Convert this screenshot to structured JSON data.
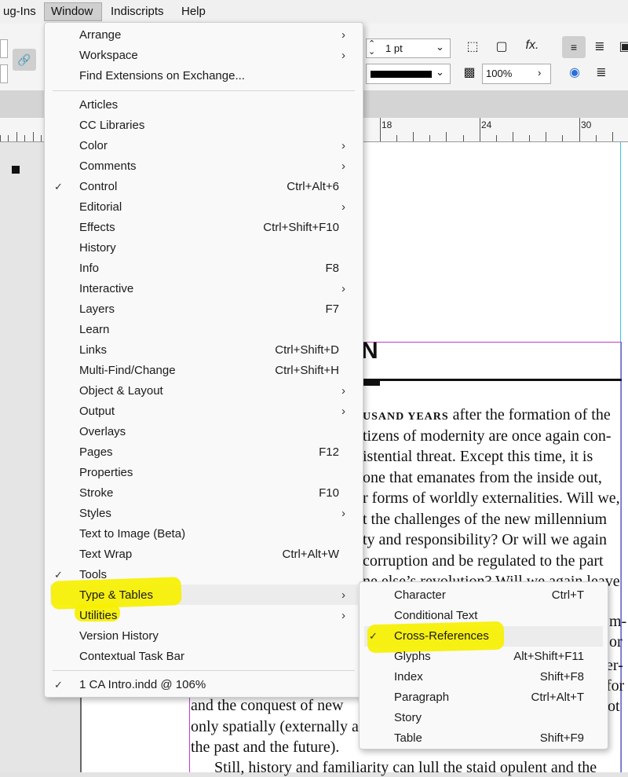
{
  "menubar": {
    "items": [
      {
        "label": "ug-Ins"
      },
      {
        "label": "Window"
      },
      {
        "label": "Indiscripts"
      },
      {
        "label": "Help"
      }
    ]
  },
  "control": {
    "stroke_weight": "1 pt",
    "opacity": "100%"
  },
  "ruler": {
    "ticks": [
      "18",
      "24",
      "30"
    ]
  },
  "document": {
    "heading_fragment": "N",
    "lines": [
      {
        "smallcaps": "USAND YEARS",
        "text": " after the formation of the"
      },
      {
        "smallcaps": "",
        "text": "tizens of modernity are once again con-"
      },
      {
        "smallcaps": "",
        "text": "istential threat. Except this time, it is"
      },
      {
        "smallcaps": "",
        "text": "one that emanates from the inside out,"
      },
      {
        "smallcaps": "",
        "text": "r forms of worldly externalities. Will we,"
      },
      {
        "smallcaps": "",
        "text": "t the challenges of the new millennium"
      },
      {
        "smallcaps": "",
        "text": "ty and responsibility? Or will we again"
      },
      {
        "smallcaps": "",
        "text": "corruption and be regulated to the part"
      },
      {
        "smallcaps": "",
        "text": "ne else’s revolution? Will we again leave"
      }
    ],
    "right_fragments": [
      "m-",
      "or",
      "er-",
      "for",
      "ot"
    ],
    "bottom_lines": [
      "and the conquest of new",
      "only spatially (externally a",
      "the past and the future).",
      "Still, history and familiarity can lull the staid opulent and the"
    ]
  },
  "window_menu": {
    "groups": [
      [
        {
          "label": "Arrange",
          "submenu": true
        },
        {
          "label": "Workspace",
          "submenu": true
        },
        {
          "label": "Find Extensions on Exchange..."
        }
      ],
      [
        {
          "label": "Articles"
        },
        {
          "label": "CC Libraries"
        },
        {
          "label": "Color",
          "submenu": true
        },
        {
          "label": "Comments",
          "submenu": true
        },
        {
          "label": "Control",
          "checked": true,
          "shortcut": "Ctrl+Alt+6"
        },
        {
          "label": "Editorial",
          "submenu": true
        },
        {
          "label": "Effects",
          "shortcut": "Ctrl+Shift+F10"
        },
        {
          "label": "History"
        },
        {
          "label": "Info",
          "shortcut": "F8"
        },
        {
          "label": "Interactive",
          "submenu": true
        },
        {
          "label": "Layers",
          "shortcut": "F7"
        },
        {
          "label": "Learn"
        },
        {
          "label": "Links",
          "shortcut": "Ctrl+Shift+D"
        },
        {
          "label": "Multi-Find/Change",
          "shortcut": "Ctrl+Shift+H"
        },
        {
          "label": "Object & Layout",
          "submenu": true
        },
        {
          "label": "Output",
          "submenu": true
        },
        {
          "label": "Overlays"
        },
        {
          "label": "Pages",
          "shortcut": "F12"
        },
        {
          "label": "Properties"
        },
        {
          "label": "Stroke",
          "shortcut": "F10"
        },
        {
          "label": "Styles",
          "submenu": true
        },
        {
          "label": "Text to Image (Beta)"
        },
        {
          "label": "Text Wrap",
          "shortcut": "Ctrl+Alt+W"
        },
        {
          "label": "Tools",
          "checked": true
        },
        {
          "label": "Type & Tables",
          "submenu": true,
          "highlighted": true
        },
        {
          "label": "Utilities",
          "submenu": true
        },
        {
          "label": "Version History"
        },
        {
          "label": "Contextual Task Bar"
        }
      ],
      [
        {
          "label": "1 CA Intro.indd @ 106%",
          "checked": true
        }
      ]
    ]
  },
  "type_tables_submenu": {
    "items": [
      {
        "label": "Character",
        "shortcut": "Ctrl+T"
      },
      {
        "label": "Conditional Text"
      },
      {
        "label": "Cross-References",
        "checked": true,
        "highlighted": true
      },
      {
        "label": "Glyphs",
        "shortcut": "Alt+Shift+F11"
      },
      {
        "label": "Index",
        "shortcut": "Shift+F8"
      },
      {
        "label": "Paragraph",
        "shortcut": "Ctrl+Alt+T"
      },
      {
        "label": "Story"
      },
      {
        "label": "Table",
        "shortcut": "Shift+F9"
      }
    ]
  },
  "colors": {
    "highlighter": "#f6f000",
    "guide": "#c33bc7",
    "menu_hover": "#ececec"
  }
}
